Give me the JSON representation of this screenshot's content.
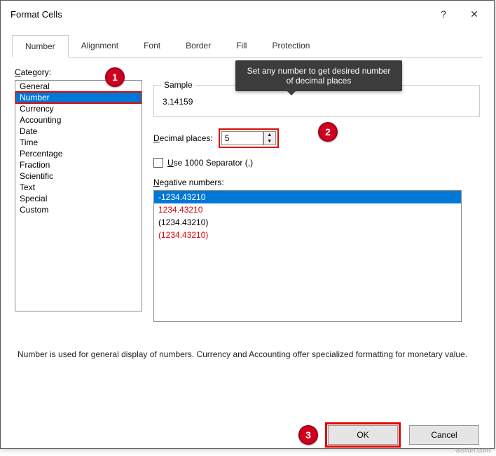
{
  "title": "Format Cells",
  "help_icon": "?",
  "close_icon": "✕",
  "tabs": {
    "number": "Number",
    "alignment": "Alignment",
    "font": "Font",
    "border": "Border",
    "fill": "Fill",
    "protection": "Protection"
  },
  "category_label_prefix": "C",
  "category_label_rest": "ategory:",
  "categories": [
    "General",
    "Number",
    "Currency",
    "Accounting",
    "Date",
    "Time",
    "Percentage",
    "Fraction",
    "Scientific",
    "Text",
    "Special",
    "Custom"
  ],
  "selected_category_index": 1,
  "sample": {
    "legend": "Sample",
    "value": "3.14159"
  },
  "decimal": {
    "prefix": "D",
    "rest": "ecimal places:",
    "value": "5"
  },
  "separator": {
    "prefix": "U",
    "rest": "se 1000 Separator (,)"
  },
  "negative": {
    "prefix": "N",
    "rest": "egative numbers:",
    "items": [
      {
        "text": "-1234.43210",
        "red": false,
        "selected": true
      },
      {
        "text": "1234.43210",
        "red": true,
        "selected": false
      },
      {
        "text": "(1234.43210)",
        "red": false,
        "selected": false
      },
      {
        "text": "(1234.43210)",
        "red": true,
        "selected": false
      }
    ]
  },
  "description": "Number is used for general display of numbers.  Currency and Accounting offer specialized formatting for monetary value.",
  "buttons": {
    "ok": "OK",
    "cancel": "Cancel"
  },
  "tooltip": "Set any number to get desired number of decimal places",
  "badges": {
    "b1": "1",
    "b2": "2",
    "b3": "3"
  },
  "watermark": "wsxdn.com"
}
